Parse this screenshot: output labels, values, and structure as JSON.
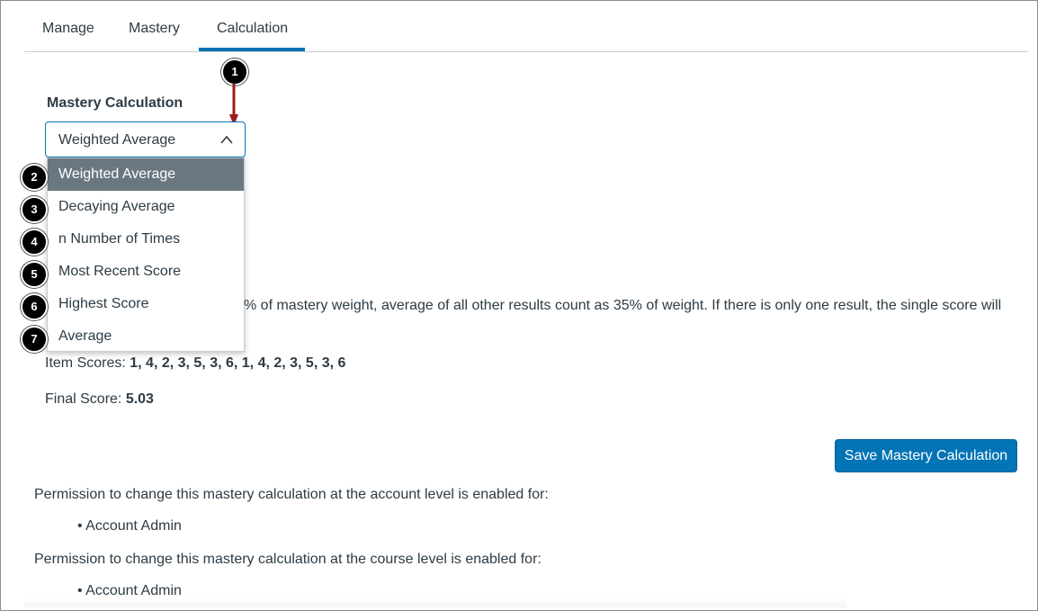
{
  "tabs": [
    {
      "label": "Manage"
    },
    {
      "label": "Mastery"
    },
    {
      "label": "Calculation"
    }
  ],
  "active_tab": "Calculation",
  "section_title": "Mastery Calculation",
  "select": {
    "value": "Weighted Average",
    "expanded": true
  },
  "menu": {
    "items": [
      {
        "label": "Weighted Average",
        "selected": true
      },
      {
        "label": "Decaying Average"
      },
      {
        "label": "n Number of Times"
      },
      {
        "label": "Most Recent Score"
      },
      {
        "label": "Highest Score"
      },
      {
        "label": "Average"
      }
    ]
  },
  "callouts": [
    "1",
    "2",
    "3",
    "4",
    "5",
    "6",
    "7"
  ],
  "description_partial": "% of mastery weight, average of all other results count as 35% of weight. If there is only one result, the single score will",
  "item_scores": {
    "label": "Item Scores: ",
    "value": "1, 4, 2, 3, 5, 3, 6, 1, 4, 2, 3, 5, 3, 6"
  },
  "final_score": {
    "label": "Final Score: ",
    "value": "5.03"
  },
  "save_button": "Save Mastery Calculation",
  "permissions": {
    "account_text": "Permission to change this mastery calculation at the account level is enabled for:",
    "account_roles": [
      "Account Admin"
    ],
    "course_text": "Permission to change this mastery calculation at the course level is enabled for:",
    "course_roles": [
      "Account Admin"
    ]
  },
  "colors": {
    "accent": "#0374b5",
    "selected_item": "#6b7780",
    "arrow": "#9b1c1c",
    "callout": "#000000"
  }
}
